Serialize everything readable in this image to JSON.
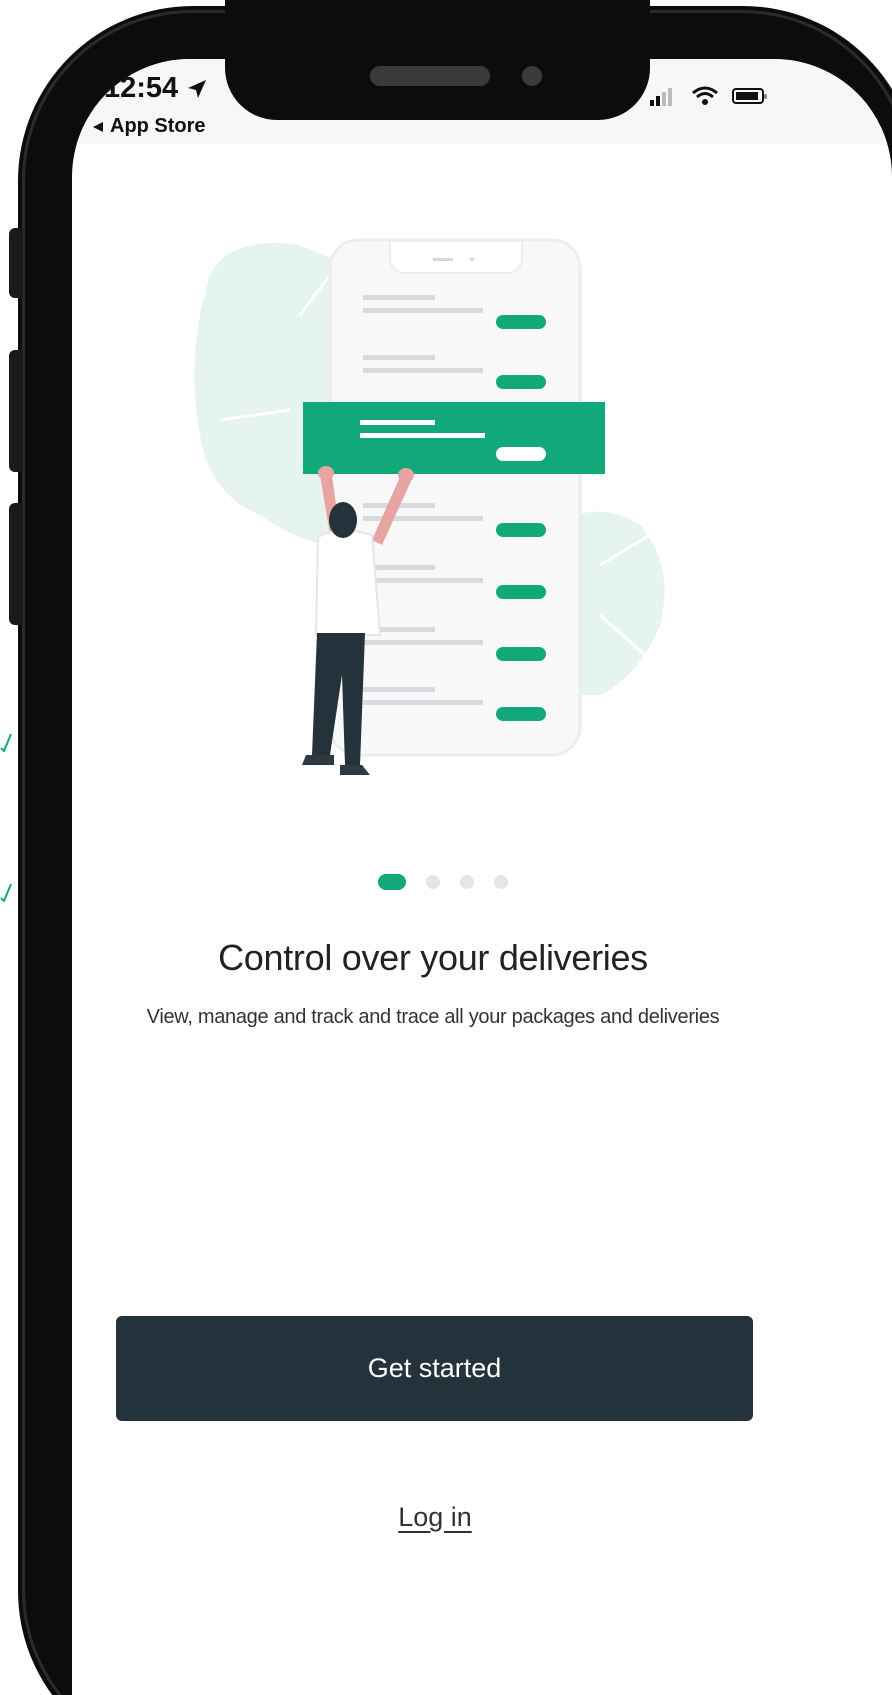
{
  "status_bar": {
    "time": "12:54",
    "back_label": "App Store",
    "icons": [
      "location-arrow-icon",
      "signal-bars-icon",
      "wifi-icon",
      "battery-icon"
    ]
  },
  "onboarding": {
    "pager": {
      "total": 4,
      "active_index": 0
    },
    "title": "Control over your deliveries",
    "description": "View, manage and track and trace all your packages and deliveries"
  },
  "actions": {
    "primary_label": "Get started",
    "secondary_label": "Log in"
  },
  "colors": {
    "accent": "#12a97a",
    "button_bg": "#24323c",
    "blob": "#e6f4ee"
  }
}
